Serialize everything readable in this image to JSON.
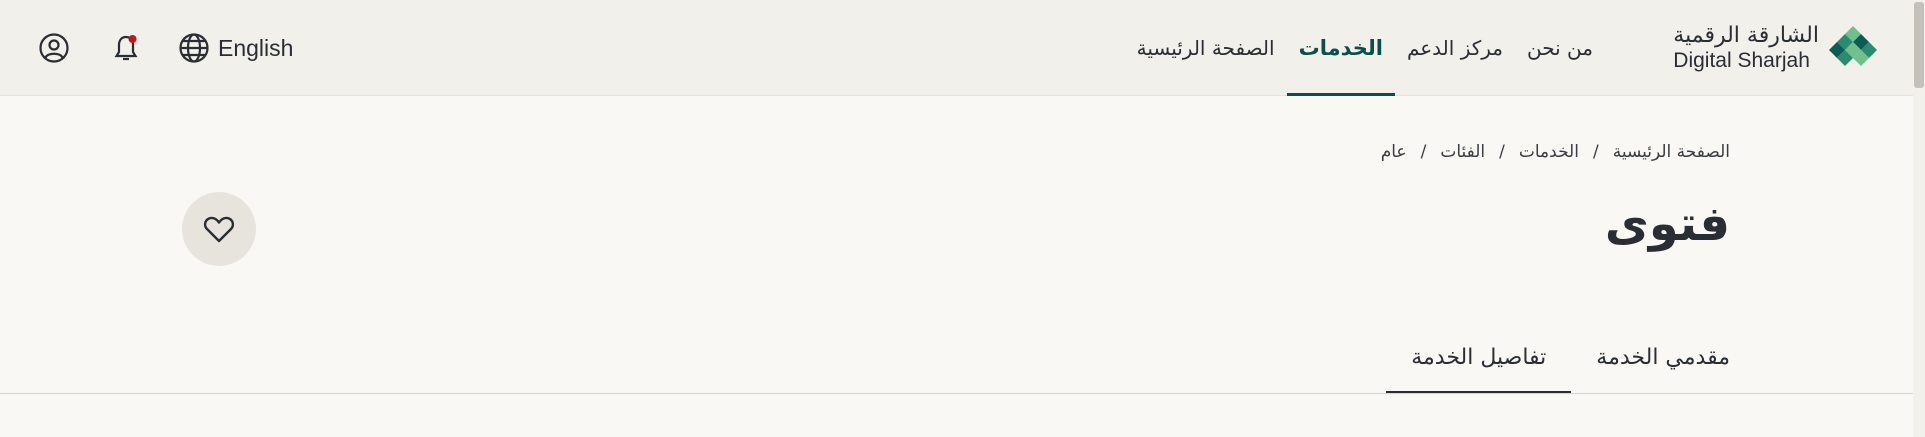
{
  "logo": {
    "name_ar": "الشارقة الرقمية",
    "name_en": "Digital Sharjah",
    "colors": [
      "#2a8b6f",
      "#6fc08b",
      "#0b5c55"
    ]
  },
  "nav": {
    "items": [
      {
        "label": "الصفحة الرئيسية",
        "active": false
      },
      {
        "label": "الخدمات",
        "active": true
      },
      {
        "label": "مركز الدعم",
        "active": false
      },
      {
        "label": "من نحن",
        "active": false
      }
    ]
  },
  "utils": {
    "language_label": "English",
    "icons": [
      "profile-icon",
      "bell-icon",
      "globe-icon"
    ],
    "notification_dot_color": "#c0171c"
  },
  "breadcrumb": {
    "items": [
      "الصفحة الرئيسية",
      "الخدمات",
      "الفئات",
      "عام"
    ],
    "separator": "/"
  },
  "page": {
    "title": "فتوى"
  },
  "tabs": [
    {
      "label": "تفاصيل الخدمة",
      "active": true
    },
    {
      "label": "مقدمي الخدمة",
      "active": false
    }
  ],
  "colors": {
    "accent": "#0b4f4a",
    "header_bg": "#f1f0ea",
    "page_bg": "#f9f8f5"
  }
}
